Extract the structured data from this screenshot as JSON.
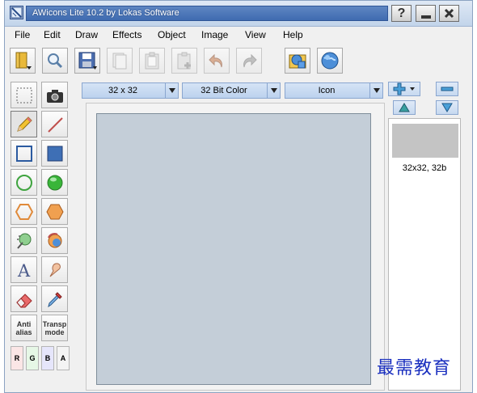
{
  "window": {
    "title": "AWicons Lite 10.2 by Lokas Software",
    "help_label": "?"
  },
  "menu": [
    "File",
    "Edit",
    "Draw",
    "Effects",
    "Object",
    "Image",
    "View",
    "Help"
  ],
  "toolbar": {
    "buttons": [
      "new-file",
      "zoom",
      "save",
      "copy-format",
      "paste",
      "paste-new",
      "undo",
      "redo",
      "open-library",
      "web-update"
    ]
  },
  "tools": {
    "antialias_line1": "Anti",
    "antialias_line2": "alias",
    "transp_line1": "Transp",
    "transp_line2": "mode",
    "channels": [
      "R",
      "G",
      "B",
      "A"
    ]
  },
  "options": {
    "size": "32 x 32",
    "color_depth": "32 Bit Color",
    "type": "Icon"
  },
  "formats": {
    "item_label": "32x32, 32b"
  },
  "watermark": "最需教育",
  "colors": {
    "title_bar": "#4a75b8",
    "canvas": "#c4ced8",
    "combo": "#c8dbf2",
    "watermark": "#1a2fbf"
  }
}
